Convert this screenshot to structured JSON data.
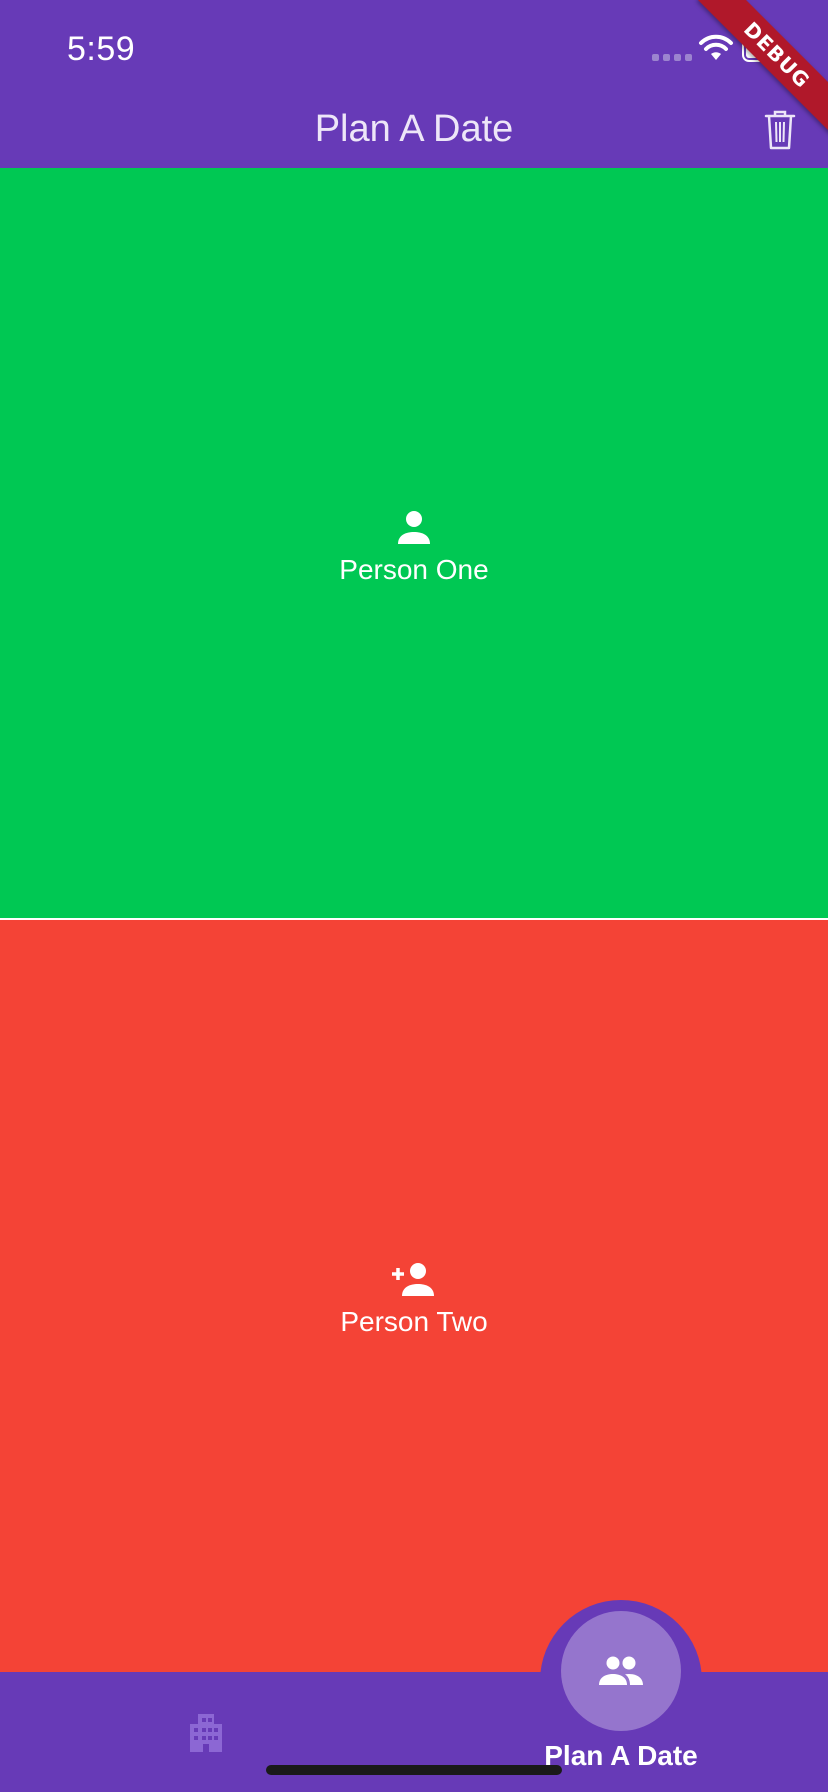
{
  "status_bar": {
    "time": "5:59"
  },
  "app_bar": {
    "title": "Plan A Date",
    "action_icon": "trash-icon"
  },
  "debug_banner": {
    "label": "DEBUG"
  },
  "panels": [
    {
      "label": "Person One",
      "icon": "person-icon",
      "color": "#00C853"
    },
    {
      "label": "Person Two",
      "icon": "person-add-icon",
      "color": "#F44336"
    }
  ],
  "bottom_nav": {
    "items": [
      {
        "icon": "building-icon",
        "label": ""
      },
      {
        "icon": "people-icon",
        "label": "Plan A Date",
        "active": true
      }
    ]
  },
  "colors": {
    "primary": "#673AB7",
    "fab": "#9575CD",
    "person_one": "#00C853",
    "person_two": "#F44336"
  }
}
